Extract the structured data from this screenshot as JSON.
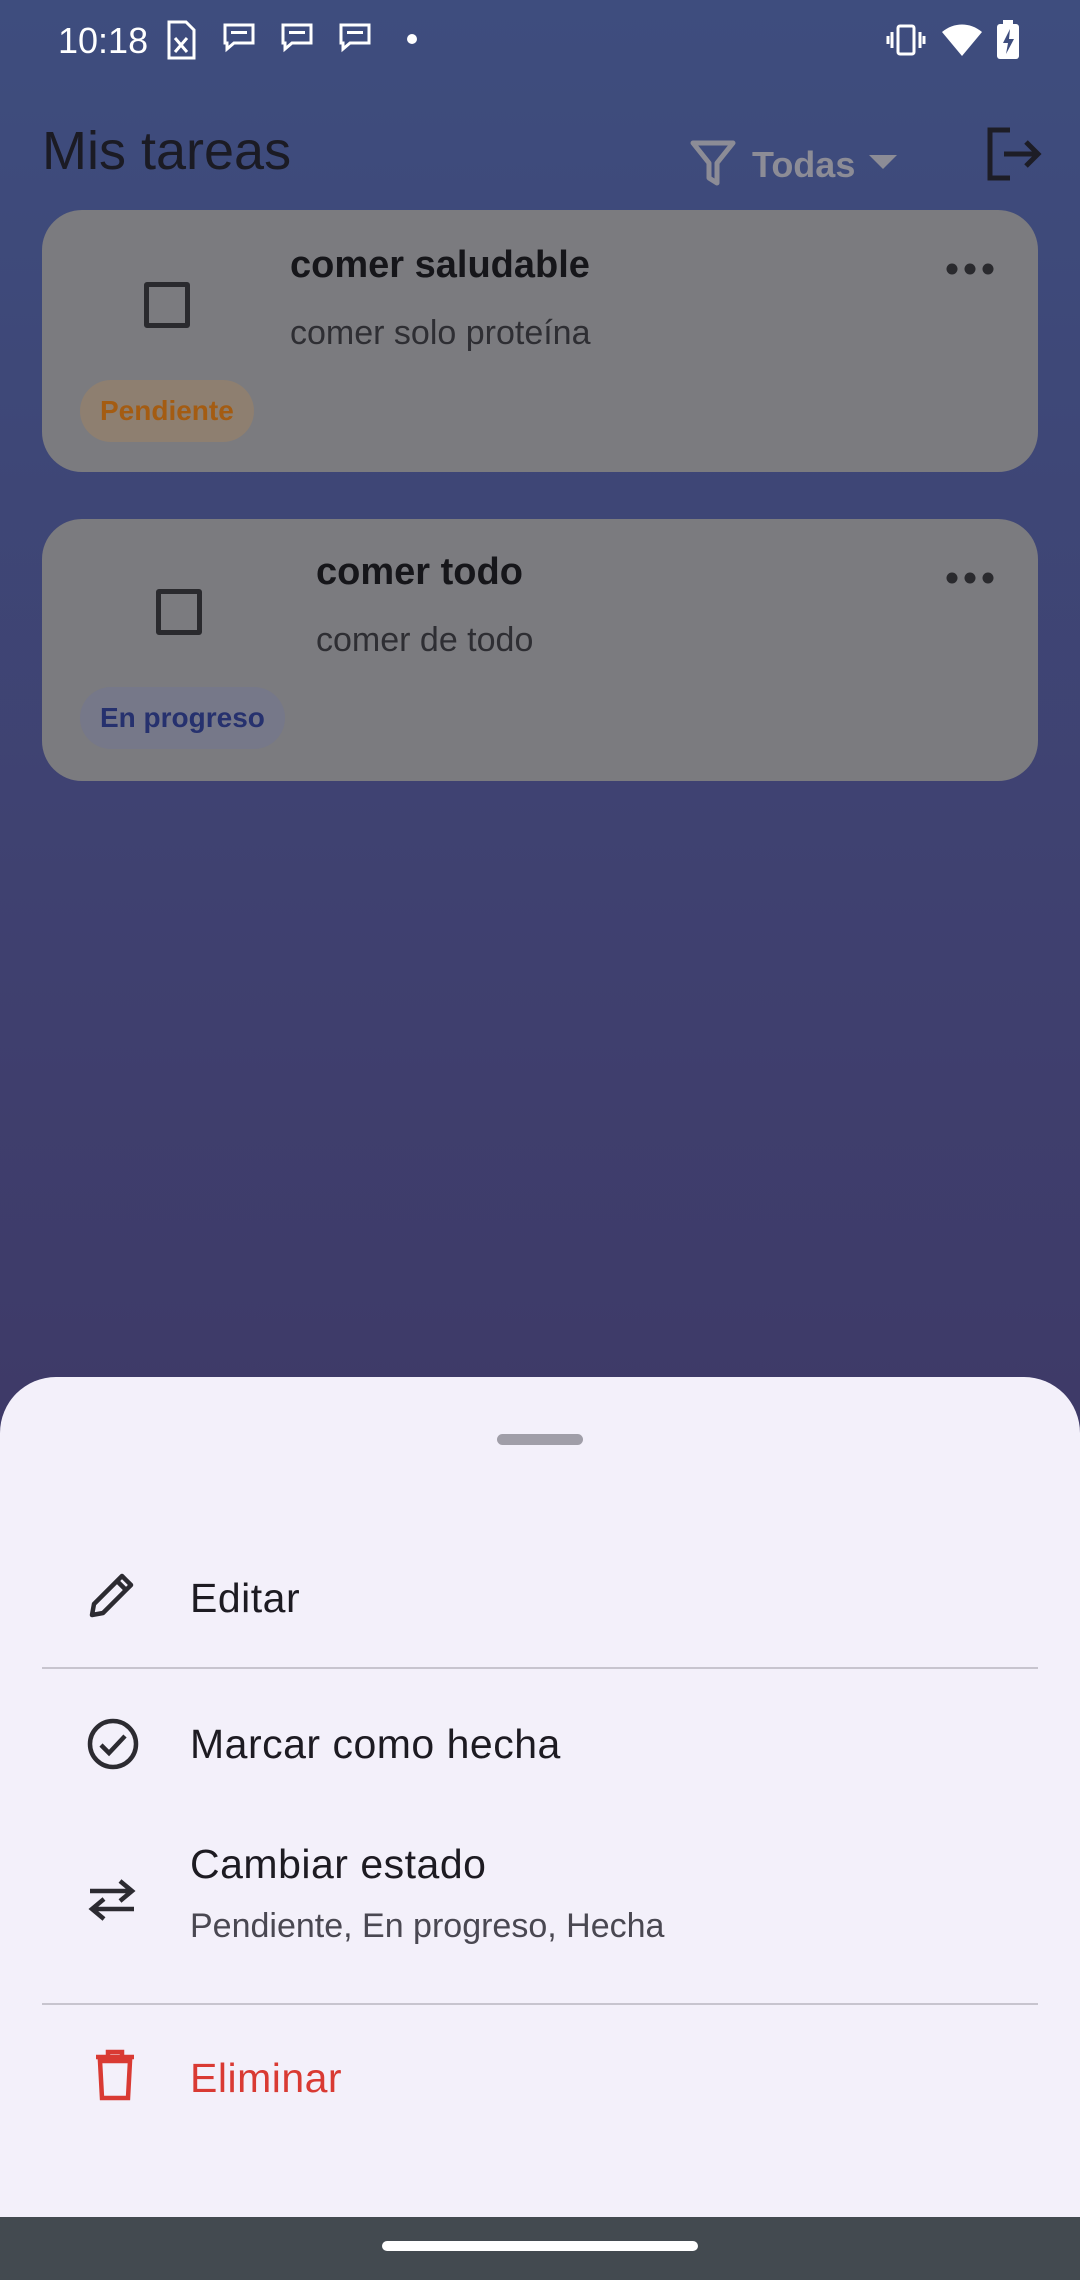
{
  "status_bar": {
    "time": "10:18",
    "icons_left": [
      "document-x-icon",
      "message-icon",
      "message-icon",
      "message-icon",
      "dot-icon"
    ],
    "icons_right": [
      "vibrate-icon",
      "wifi-icon",
      "battery-charging-icon"
    ]
  },
  "app_bar": {
    "title": "Mis tareas",
    "filter_label": "Todas",
    "filter_icon": "filter-icon",
    "logout_icon": "logout-icon"
  },
  "tasks": [
    {
      "title": "comer saludable",
      "subtitle": "comer solo proteína",
      "status": "Pendiente",
      "status_color": "#a45c12",
      "done": false
    },
    {
      "title": "comer todo",
      "subtitle": "comer de todo",
      "status": "En progreso",
      "status_color": "#26316e",
      "done": false
    }
  ],
  "sheet": {
    "items": [
      {
        "label": "Editar",
        "icon": "pencil-icon"
      },
      {
        "label": "Marcar como hecha",
        "icon": "check-circle-icon"
      },
      {
        "label": "Cambiar estado",
        "sublabel": "Pendiente, En progreso, Hecha",
        "icon": "swap-icon"
      },
      {
        "label": "Eliminar",
        "icon": "trash-icon",
        "color": "#d93a33"
      }
    ]
  },
  "colors": {
    "background_top": "#3e4d7e",
    "background_bottom": "#3c2f5a",
    "sheet": "#f3f0fa",
    "danger": "#d93a33"
  }
}
